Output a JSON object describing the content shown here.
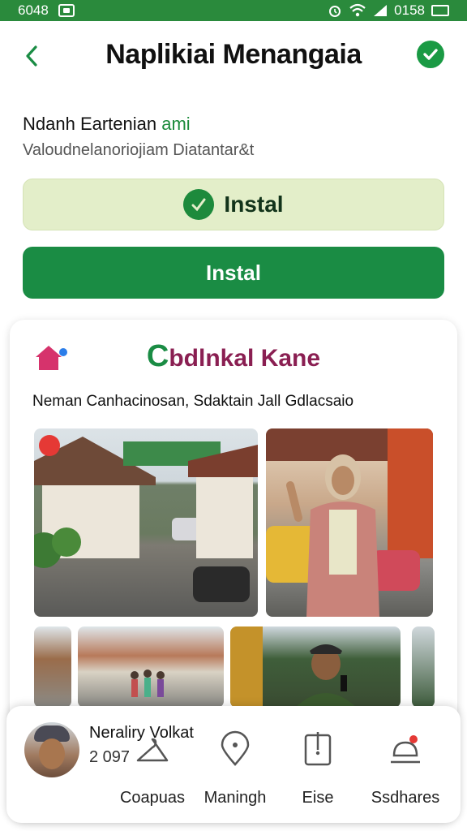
{
  "status_bar": {
    "left_text": "6048",
    "time": "0158"
  },
  "header": {
    "title": "Naplikiai Menangaia",
    "back_icon": "chevron-left-icon",
    "confirm_icon": "check-circle-icon"
  },
  "app_info": {
    "name_prefix": "Ndanh Eartenian",
    "name_accent": "ami",
    "subtitle": "Valoudnelanoriojiam Diatantar&t"
  },
  "buttons": {
    "install_secondary": "Instal",
    "install_primary": "Instal"
  },
  "card": {
    "brand_c": "C",
    "brand_text": "bdlnkal Kane",
    "caption": "Neman Canhacinosan, Sdaktain Jall Gdlacsaio"
  },
  "bottom_bar": {
    "user_name": "Neraliry Volkat",
    "user_number": "2 097",
    "nav": [
      {
        "label": "Coapuas",
        "icon": "hanger-icon"
      },
      {
        "label": "Maningh",
        "icon": "location-pin-icon"
      },
      {
        "label": "Eise",
        "icon": "clipboard-icon"
      },
      {
        "label": "Ssdhares",
        "icon": "share-user-icon"
      }
    ]
  },
  "colors": {
    "accent_green": "#1a8c44",
    "status_bar": "#2a8a3c",
    "light_button": "#e3eec9",
    "brand_maroon": "#8a1f52"
  }
}
